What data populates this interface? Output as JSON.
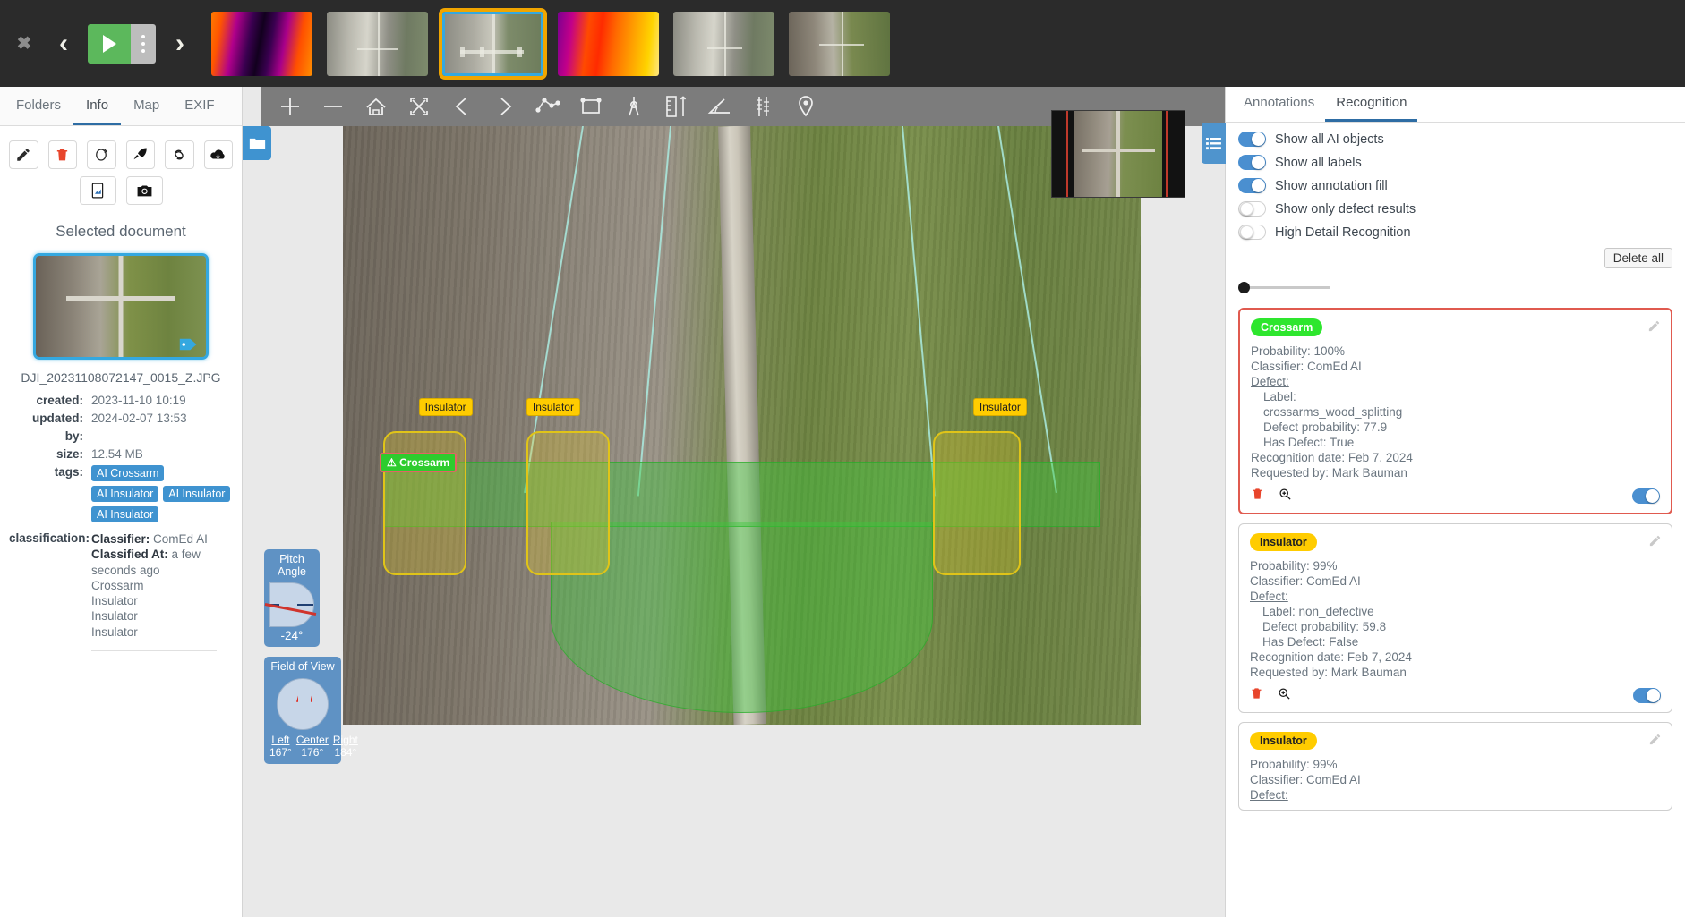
{
  "topbar": {
    "close_label": "✖",
    "prev_label": "‹",
    "next_label": "›",
    "play_icon": "play-icon",
    "menu_icon": "kebab-menu-icon",
    "thumbnails": [
      {
        "name": "thumb-thermal-1",
        "kind": "thermal1",
        "selected": false
      },
      {
        "name": "thumb-aerial-1",
        "kind": "aerial1",
        "selected": false
      },
      {
        "name": "thumb-aerial-selected",
        "kind": "aerial2",
        "selected": true
      },
      {
        "name": "thumb-thermal-2",
        "kind": "thermal2",
        "selected": false
      },
      {
        "name": "thumb-aerial-2",
        "kind": "aerial1",
        "selected": false
      },
      {
        "name": "thumb-aerial-3",
        "kind": "aerial3",
        "selected": false
      }
    ]
  },
  "left_panel": {
    "tabs": [
      {
        "label": "Folders",
        "active": false
      },
      {
        "label": "Info",
        "active": true
      },
      {
        "label": "Map",
        "active": false
      },
      {
        "label": "EXIF",
        "active": false
      }
    ],
    "actions_row1": [
      {
        "icon": "pencil-icon",
        "label": "Edit"
      },
      {
        "icon": "trash-icon",
        "label": "Delete"
      },
      {
        "icon": "rotate-icon",
        "label": "Rotate"
      },
      {
        "icon": "rocket-icon",
        "label": "Publish"
      },
      {
        "icon": "link-icon",
        "label": "Link"
      },
      {
        "icon": "cloud-download-icon",
        "label": "Download"
      }
    ],
    "actions_row2": [
      {
        "icon": "report-icon",
        "label": "Report"
      },
      {
        "icon": "camera-icon",
        "label": "Snapshot"
      }
    ],
    "selected_document_title": "Selected document",
    "filename": "DJI_20231108072147_0015_Z.JPG",
    "fields": [
      {
        "label": "created:",
        "value": "2023-11-10 10:19"
      },
      {
        "label": "updated:",
        "value": "2024-02-07 13:53"
      },
      {
        "label": "by:",
        "value": ""
      },
      {
        "label": "size:",
        "value": "12.54 MB"
      }
    ],
    "tags_label": "tags:",
    "tags": [
      "AI Crossarm",
      "AI Insulator",
      "AI Insulator",
      "AI Insulator"
    ],
    "classification_label": "classification:",
    "classification": {
      "classifier_key": "Classifier:",
      "classifier_value": "ComEd AI",
      "classified_at_key": "Classified At:",
      "classified_at_value": "a few seconds ago",
      "items": [
        "Crossarm",
        "Insulator",
        "Insulator",
        "Insulator"
      ]
    }
  },
  "viewer": {
    "tools": [
      {
        "icon": "point-icon",
        "label": "Point"
      },
      {
        "icon": "line-icon",
        "label": "Line"
      },
      {
        "icon": "home-icon",
        "label": "Home"
      },
      {
        "icon": "fit-screen-icon",
        "label": "Fit to screen"
      },
      {
        "icon": "chevron-left-icon",
        "label": "Previous"
      },
      {
        "icon": "chevron-right-icon",
        "label": "Next"
      },
      {
        "icon": "polygon-icon",
        "label": "Polygon"
      },
      {
        "icon": "rectangle-icon",
        "label": "Rectangle"
      },
      {
        "icon": "compass-icon",
        "label": "Compass"
      },
      {
        "icon": "ruler-icon",
        "label": "Measure"
      },
      {
        "icon": "angle-icon",
        "label": "Angle"
      },
      {
        "icon": "vertical-measure-icon",
        "label": "Height"
      },
      {
        "icon": "map-pin-icon",
        "label": "Marker"
      }
    ],
    "folder_icon": "folder-icon",
    "minimap_name": "minimap-overview",
    "annotations": [
      {
        "label": "Insulator",
        "type": "insulator"
      },
      {
        "label": "Insulator",
        "type": "insulator"
      },
      {
        "label": "Insulator",
        "type": "insulator"
      },
      {
        "label": "Crossarm",
        "type": "crossarm",
        "warning": "⚠"
      }
    ],
    "pitch_gauge": {
      "title_line1": "Pitch",
      "title_line2": "Angle",
      "value": "-24°"
    },
    "fov_gauge": {
      "title": "Field of View",
      "left_key": "Left",
      "left_value": "167°",
      "center_key": "Center",
      "center_value": "176°",
      "right_key": "Right",
      "right_value": "184°"
    }
  },
  "right_panel": {
    "tabs": [
      {
        "label": "Annotations",
        "active": false
      },
      {
        "label": "Recognition",
        "active": true
      }
    ],
    "list_icon": "list-icon",
    "toggles": [
      {
        "label": "Show all AI objects",
        "on": true
      },
      {
        "label": "Show all labels",
        "on": true
      },
      {
        "label": "Show annotation fill",
        "on": true
      },
      {
        "label": "Show only defect results",
        "on": false
      },
      {
        "label": "High Detail Recognition",
        "on": false
      }
    ],
    "delete_all_label": "Delete all",
    "slider_name": "opacity-slider",
    "cards": [
      {
        "badge": "Crossarm",
        "badge_color": "green",
        "has_defect_border": true,
        "probability": "Probability: 100%",
        "classifier": "Classifier: ComEd AI",
        "defect_header": "Defect:",
        "defect_label_key": "Label:",
        "defect_label_value": "crossarms_wood_splitting",
        "defect_probability": "Defect probability: 77.9",
        "has_defect": "Has Defect: True",
        "recognition_date": "Recognition date: Feb 7, 2024",
        "requested_by": "Requested by: Mark Bauman",
        "toggle_on": true
      },
      {
        "badge": "Insulator",
        "badge_color": "yellow",
        "has_defect_border": false,
        "probability": "Probability: 99%",
        "classifier": "Classifier: ComEd AI",
        "defect_header": "Defect:",
        "defect_label_key": "Label: non_defective",
        "defect_label_value": "",
        "defect_probability": "Defect probability: 59.8",
        "has_defect": "Has Defect: False",
        "recognition_date": "Recognition date: Feb 7, 2024",
        "requested_by": "Requested by: Mark Bauman",
        "toggle_on": true
      },
      {
        "badge": "Insulator",
        "badge_color": "yellow",
        "has_defect_border": false,
        "probability": "Probability: 99%",
        "classifier": "Classifier: ComEd AI",
        "defect_header": "Defect:",
        "defect_label_key": "",
        "defect_label_value": "",
        "defect_probability": "",
        "has_defect": "",
        "recognition_date": "",
        "requested_by": "",
        "toggle_on": true
      }
    ]
  },
  "colors": {
    "accent_blue": "#4a8fd0",
    "defect_red": "#e05a4f",
    "crossarm_green": "#2ee62e",
    "insulator_yellow": "#ffcc00",
    "tag_blue": "#3f93d0"
  }
}
